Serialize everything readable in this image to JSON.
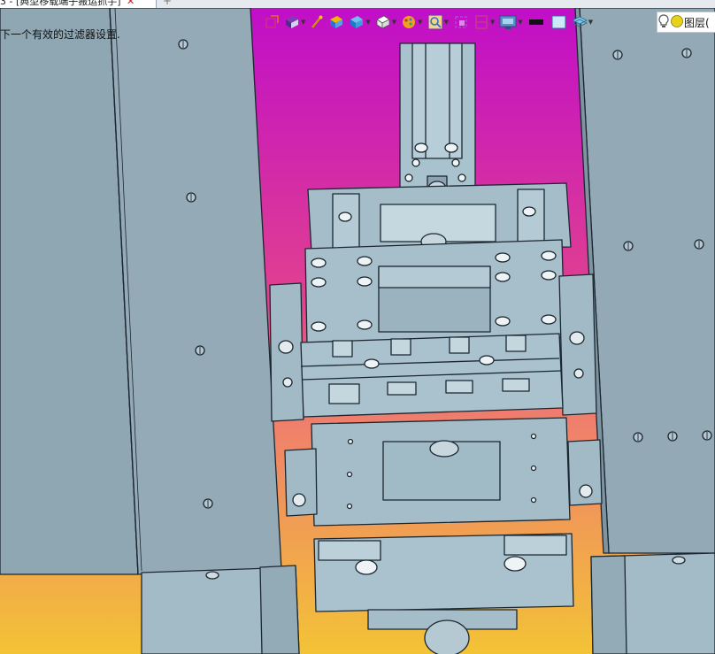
{
  "tab": {
    "title": "3 - [典型移载端子搬运抓手]",
    "close_glyph": "✕",
    "new_glyph": "+"
  },
  "status": {
    "text": "下一个有效的过滤器设置."
  },
  "toolbar": {
    "items": [
      {
        "name": "view-cube-icon",
        "has_menu": false
      },
      {
        "name": "render-mode-icon",
        "has_menu": true
      },
      {
        "name": "wand-icon",
        "has_menu": false
      },
      {
        "name": "shaded-box-icon",
        "has_menu": false
      },
      {
        "name": "blue-cube-icon",
        "has_menu": true
      },
      {
        "name": "white-cube-icon",
        "has_menu": true
      },
      {
        "name": "scene-lighting-icon",
        "has_menu": true
      },
      {
        "name": "zoom-icon",
        "has_menu": true
      },
      {
        "name": "section-icon",
        "has_menu": false
      },
      {
        "name": "clipping-icon",
        "has_menu": true
      },
      {
        "name": "display-settings-icon",
        "has_menu": true
      },
      {
        "name": "line-color-icon",
        "has_menu": false
      },
      {
        "name": "background-color-icon",
        "has_menu": false
      },
      {
        "name": "layer-icon",
        "has_menu": true
      }
    ],
    "layer_label": "图层("
  },
  "colors": {
    "accent": "#d000d0",
    "background_top": "#c512c9",
    "background_mid": "#e96a8a",
    "background_bottom": "#f0b63c",
    "plate": "#93a9b6",
    "part": "#a8c2cd",
    "line": "#1b2730"
  }
}
